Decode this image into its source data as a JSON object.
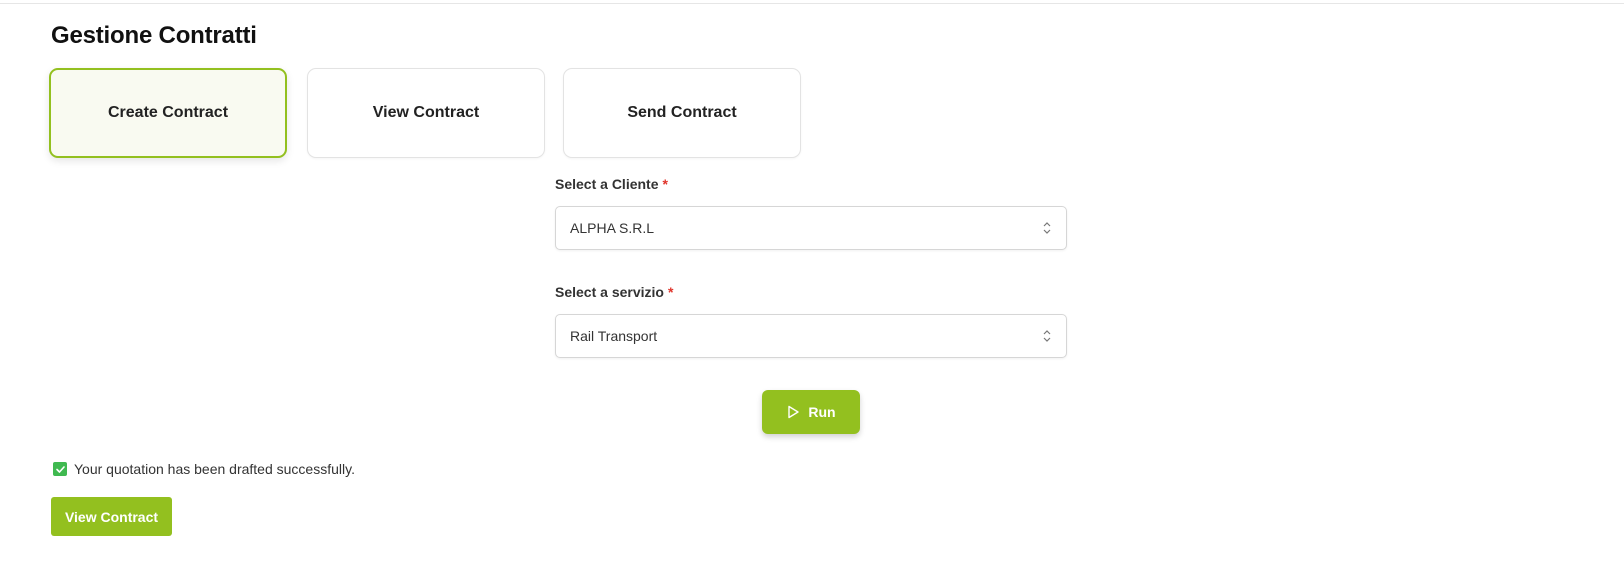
{
  "page": {
    "title": "Gestione Contratti"
  },
  "tabs": [
    {
      "label": "Create Contract",
      "active": true
    },
    {
      "label": "View Contract",
      "active": false
    },
    {
      "label": "Send Contract",
      "active": false
    }
  ],
  "form": {
    "cliente": {
      "label": "Select a Cliente",
      "required_mark": "*",
      "value": "ALPHA S.R.L"
    },
    "servizio": {
      "label": "Select a servizio",
      "required_mark": "*",
      "value": "Rail Transport"
    },
    "run_label": "Run"
  },
  "status": {
    "message": "Your quotation has been drafted successfully."
  },
  "actions": {
    "view_contract_label": "View Contract"
  },
  "colors": {
    "accent": "#93c01f",
    "success": "#3fb950",
    "required": "#e0342b"
  },
  "icons": {
    "run": "play-icon",
    "select": "chevron-updown-icon",
    "status": "checkbox-checked-icon"
  }
}
